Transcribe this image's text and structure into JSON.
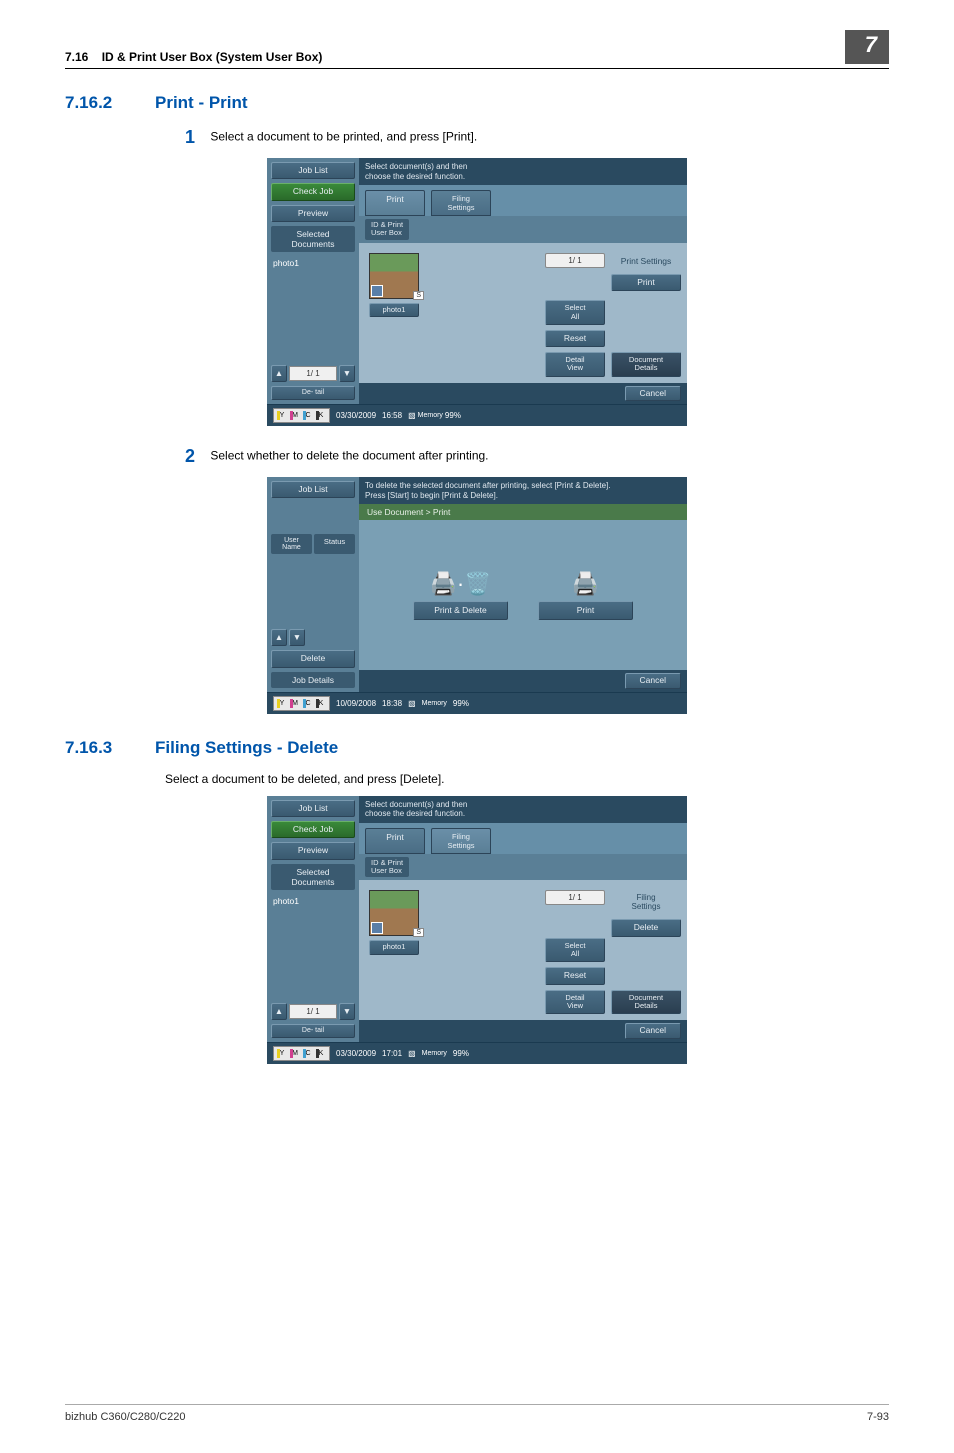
{
  "header": {
    "section_ref": "7.16",
    "section_title": "ID & Print User Box (System User Box)",
    "chapter": "7"
  },
  "s1": {
    "number": "7.16.2",
    "title": "Print - Print",
    "step1_num": "1",
    "step1_text": "Select a document to be printed, and press [Print].",
    "step2_num": "2",
    "step2_text": "Select whether to delete the document after printing."
  },
  "s2": {
    "number": "7.16.3",
    "title": "Filing Settings - Delete",
    "intro": "Select a document to be deleted, and press [Delete]."
  },
  "shot1": {
    "msg": "Select document(s) and then\nchoose the desired function.",
    "job_list": "Job List",
    "check_job": "Check Job",
    "preview": "Preview",
    "sel_docs": "Selected Documents",
    "doc1": "photo1",
    "tab_print": "Print",
    "tab_filing": "Filing\nSettings",
    "sub_userbox": "ID & Print\nUser Box",
    "thumb_badge": "S",
    "page_ind": "1/  1",
    "right_header": "Print Settings",
    "right_print": "Print",
    "select_all": "Select\nAll",
    "reset": "Reset",
    "detail_view": "Detail\nView",
    "doc_details": "Document\nDetails",
    "pager": "1/  1",
    "del": "De-\ntail",
    "cancel": "Cancel",
    "date": "03/30/2009",
    "time": "16:58",
    "mem_label": "Memory",
    "mem_pct": "99%"
  },
  "shot2": {
    "msg": "To delete the selected document after printing, select [Print & Delete].\nPress [Start] to begin [Print & Delete].",
    "job_list": "Job List",
    "user_name": "User\nName",
    "status": "Status",
    "crumb": "Use Document > Print",
    "opt1": "Print & Delete",
    "opt2": "Print",
    "delete": "Delete",
    "job_details": "Job Details",
    "cancel": "Cancel",
    "date": "10/09/2008",
    "time": "18:38",
    "mem_label": "Memory",
    "mem_pct": "99%"
  },
  "shot3": {
    "msg": "Select document(s) and then\nchoose the desired function.",
    "job_list": "Job List",
    "check_job": "Check Job",
    "preview": "Preview",
    "sel_docs": "Selected Documents",
    "doc1": "photo1",
    "tab_print": "Print",
    "tab_filing": "Filing\nSettings",
    "sub_userbox": "ID & Print\nUser Box",
    "thumb_badge": "S",
    "page_ind": "1/  1",
    "right_header": "Filing\nSettings",
    "right_delete": "Delete",
    "select_all": "Select\nAll",
    "reset": "Reset",
    "detail_view": "Detail\nView",
    "doc_details": "Document\nDetails",
    "pager": "1/  1",
    "del": "De-\ntail",
    "cancel": "Cancel",
    "date": "03/30/2009",
    "time": "17:01",
    "mem_label": "Memory",
    "mem_pct": "99%"
  },
  "footer": {
    "model": "bizhub C360/C280/C220",
    "page": "7-93"
  }
}
